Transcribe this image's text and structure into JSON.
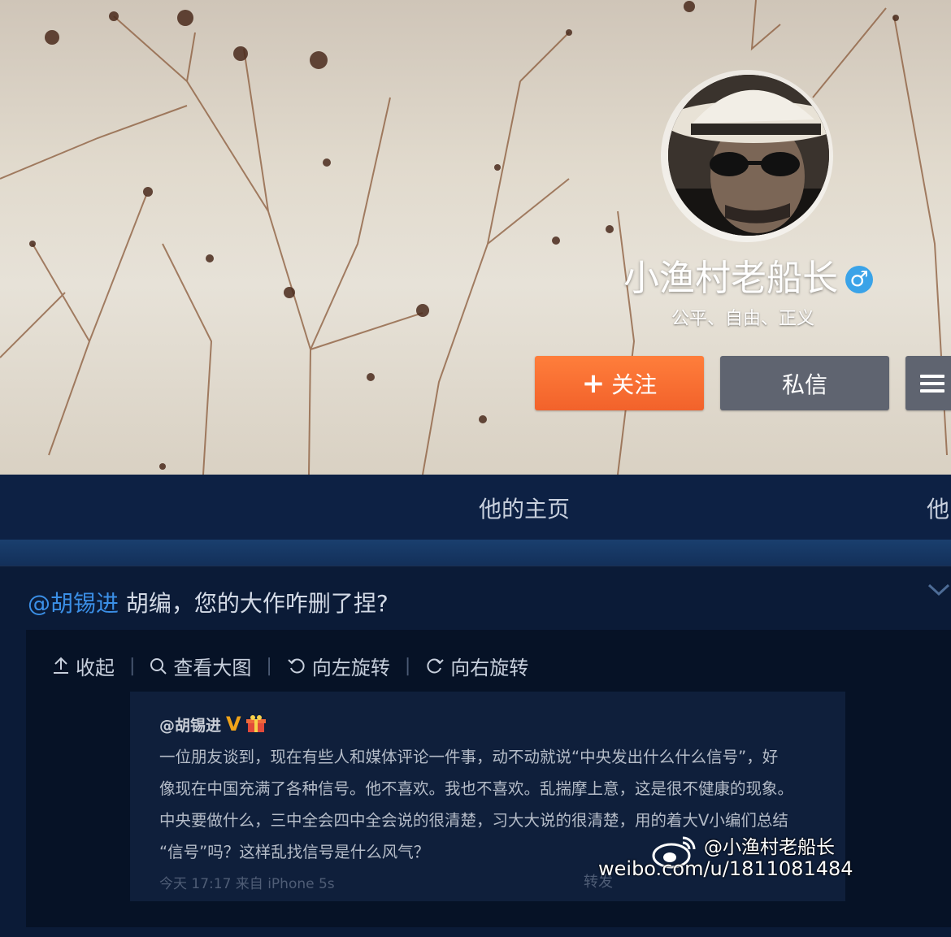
{
  "profile": {
    "name": "小渔村老船长",
    "bio": "公平、自由、正义",
    "gender_icon": "male-icon"
  },
  "actions": {
    "follow_label": "关注",
    "message_label": "私信",
    "menu_icon": "hamburger-menu-icon"
  },
  "nav": {
    "tab_home": "他的主页",
    "tab_other": "他"
  },
  "post": {
    "mention": "@胡锡进",
    "text": " 胡编，您的大作咋删了捏?"
  },
  "toolbar": {
    "collapse": "收起",
    "view_large": "查看大图",
    "rotate_left": "向左旋转",
    "rotate_right": "向右旋转"
  },
  "screenshot": {
    "author": "@胡锡进",
    "verified_badge": "V",
    "lines": [
      "一位朋友谈到，现在有些人和媒体评论一件事，动不动就说“中央发出什么什么信号”，好",
      "像现在中国充满了各种信号。他不喜欢。我也不喜欢。乱揣摩上意，这是很不健康的现象。",
      "中央要做什么，三中全会四中全会说的很清楚，习大大说的很清楚，用的着大V小编们总结",
      "“信号”吗？这样乱找信号是什么风气？"
    ],
    "meta": "今天 17:17 来自 iPhone 5s",
    "forward": "转发",
    "watermark_handle": "@小渔村老船长",
    "watermark_url": "weibo.com/u/1811081484"
  },
  "colors": {
    "follow": "#f2622b",
    "secondary_button": "#5f6470",
    "nav_bg": "#0d2144",
    "mention": "#3b8fe6",
    "verified": "#f0a31a",
    "gender": "#3aa3e8"
  }
}
